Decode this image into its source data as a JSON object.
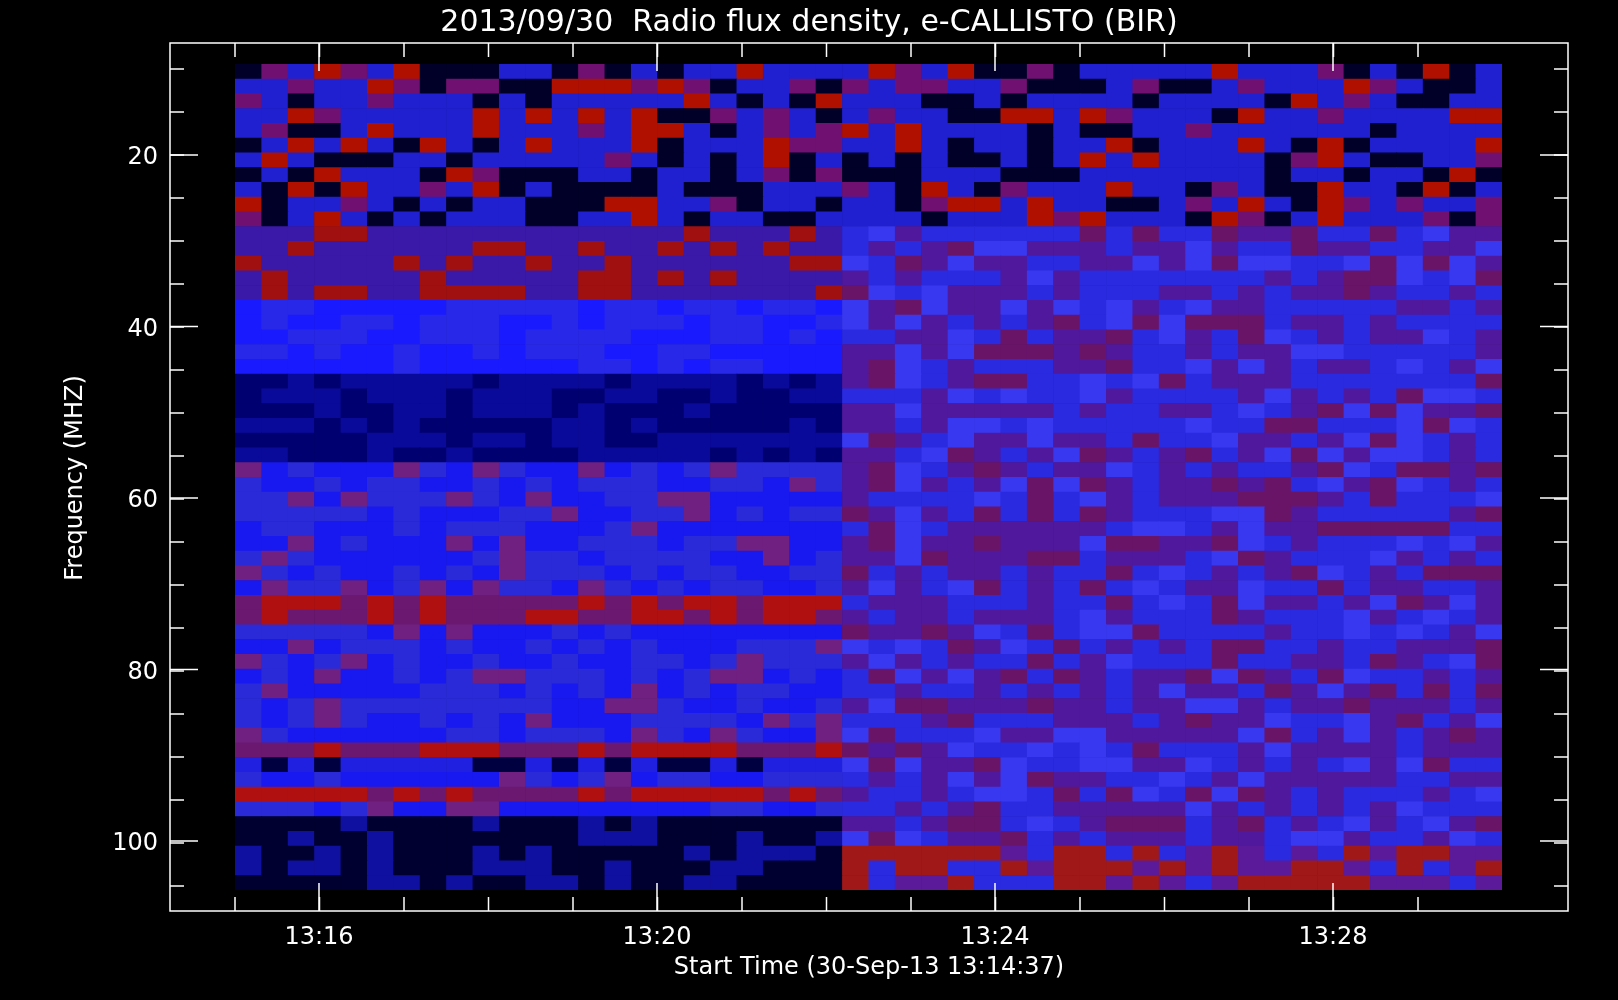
{
  "title": "2013/09/30  Radio flux density, e-CALLISTO (BIR)",
  "y_axis": {
    "label": "Frequency (MHZ)",
    "ticks": [
      "20",
      "40",
      "60",
      "80",
      "100"
    ]
  },
  "x_axis": {
    "label": "Start Time (30-Sep-13 13:14:37)",
    "ticks": [
      "13:16",
      "13:20",
      "13:24",
      "13:28"
    ]
  }
}
